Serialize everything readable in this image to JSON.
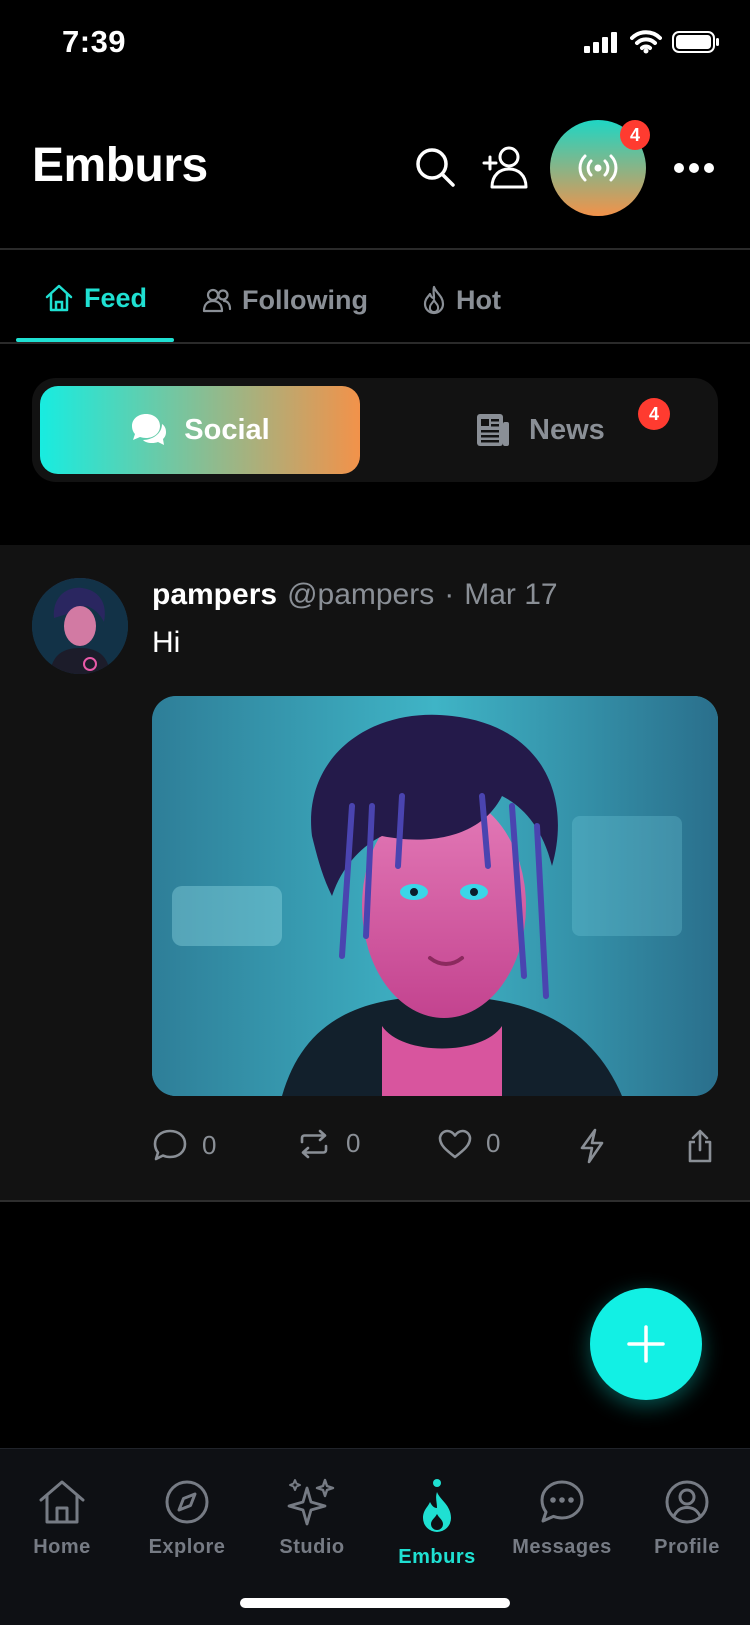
{
  "status_bar": {
    "time": "7:39"
  },
  "header": {
    "title": "Emburs",
    "live_badge": "4"
  },
  "tabs": [
    {
      "label": "Feed"
    },
    {
      "label": "Following"
    },
    {
      "label": "Hot"
    }
  ],
  "segments": {
    "social_label": "Social",
    "news_label": "News",
    "news_badge": "4"
  },
  "post": {
    "author": "pampers",
    "handle": "@pampers",
    "separator": "·",
    "date": "Mar 17",
    "text": "Hi",
    "comment_count": "0",
    "repost_count": "0",
    "like_count": "0"
  },
  "bottom_nav": [
    {
      "label": "Home",
      "icon": "home-icon"
    },
    {
      "label": "Explore",
      "icon": "compass-icon"
    },
    {
      "label": "Studio",
      "icon": "sparkles-icon"
    },
    {
      "label": "Emburs",
      "icon": "flame-icon"
    },
    {
      "label": "Messages",
      "icon": "chat-bubble-icon"
    },
    {
      "label": "Profile",
      "icon": "user-circle-icon"
    }
  ],
  "colors": {
    "accent": "#1fe0d2",
    "gradient_start": "#18ece0",
    "gradient_end": "#f2924a",
    "badge": "#ff3b30"
  }
}
